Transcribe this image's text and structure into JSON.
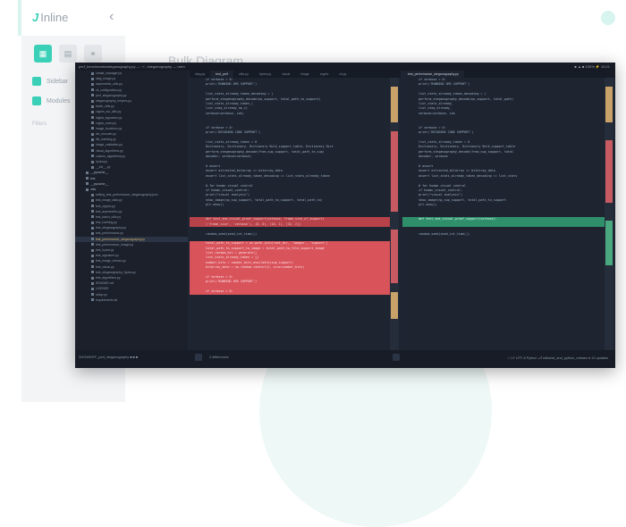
{
  "app": {
    "logo_mark": "J",
    "logo_text": "Inline",
    "collapse_glyph": "‹"
  },
  "sidebar": {
    "icons": [
      "grid-icon",
      "list-icon",
      "network-icon"
    ],
    "icon_glyphs": [
      "▦",
      "▤",
      "⚭"
    ],
    "items": [
      {
        "label": "Sidebar"
      },
      {
        "label": "Modules"
      }
    ],
    "filters_label": "Filters"
  },
  "page": {
    "title": "Bulk Diagram"
  },
  "editor": {
    "window_title": "perf_benchmarks/steganography.py — ~/.../steganography — nvim",
    "window_status": "■ ▲ ■ 100% ⚡ 10:21",
    "tree": [
      {
        "label": "create_manager.py",
        "type": "file"
      },
      {
        "label": "steg_image.py",
        "type": "file"
      },
      {
        "label": "asymmetric_utils.py",
        "type": "file"
      },
      {
        "label": "cli_configuration.py",
        "type": "file"
      },
      {
        "label": "perf_steganography.py",
        "type": "file"
      },
      {
        "label": "steganography_helpers.py",
        "type": "file"
      },
      {
        "label": "batch_utils.py",
        "type": "file"
      },
      {
        "label": "ctypes_ssl_utils.py",
        "type": "file"
      },
      {
        "label": "digital_signature.py",
        "type": "file"
      },
      {
        "label": "crypto_main.py",
        "type": "file"
      },
      {
        "label": "image_functions.py",
        "type": "file"
      },
      {
        "label": "lsb_encoder.py",
        "type": "file"
      },
      {
        "label": "file_hashing.py",
        "type": "file"
      },
      {
        "label": "image_validation.py",
        "type": "file"
      },
      {
        "label": "visual_algorithms.py",
        "type": "file"
      },
      {
        "label": "custom_algorithms.py",
        "type": "file"
      },
      {
        "label": "hydra.py",
        "type": "file"
      },
      {
        "label": "__init__.py",
        "type": "file"
      },
      {
        "label": "__pycache__",
        "type": "dir"
      },
      {
        "label": "test",
        "type": "dir"
      },
      {
        "label": "__pycache__",
        "type": "dir"
      },
      {
        "label": "utils",
        "type": "dir"
      },
      {
        "label": "setting_test_performance_steganography.json",
        "type": "file"
      },
      {
        "label": "test_image_data.py",
        "type": "file"
      },
      {
        "label": "test_ctypes.py",
        "type": "file"
      },
      {
        "label": "test_asymmetric.py",
        "type": "file"
      },
      {
        "label": "test_batch_utils.py",
        "type": "file"
      },
      {
        "label": "test_hashing.py",
        "type": "file"
      },
      {
        "label": "test_steganography.py",
        "type": "file"
      },
      {
        "label": "test_performance.py",
        "type": "file"
      },
      {
        "label": "test_performance_steganography.py",
        "type": "file",
        "selected": true
      },
      {
        "label": "test_performance_image.py",
        "type": "file"
      },
      {
        "label": "test_hydra.py",
        "type": "file"
      },
      {
        "label": "test_signature.py",
        "type": "file"
      },
      {
        "label": "test_image_checks.py",
        "type": "file"
      },
      {
        "label": "test_visual.py",
        "type": "file"
      },
      {
        "label": "test_steganography_hydra.py",
        "type": "file"
      },
      {
        "label": "test_algorithms.py",
        "type": "file"
      },
      {
        "label": "README.md",
        "type": "file"
      },
      {
        "label": "LICENSE",
        "type": "file"
      },
      {
        "label": "setup.py",
        "type": "file"
      },
      {
        "label": "requirements.txt",
        "type": "file"
      }
    ],
    "left_tabs": [
      "steg.py",
      "test_perf",
      "utils.py",
      "hydra.py",
      "visual",
      "image",
      "crypto",
      "cli.py"
    ],
    "right_tabs": [
      "test_performance_steganography.py"
    ],
    "left_code": [
      {
        "text": "if verbose > 0:",
        "kind": "normal"
      },
      {
        "text": "    print('RUNNING SMS SUPPORT')",
        "kind": "normal"
      },
      {
        "text": "",
        "kind": "normal"
      },
      {
        "text": "list_stats_already_taken_decoding = (",
        "kind": "normal"
      },
      {
        "text": "    perform_steganography_decode(np_support, total_path_to_support)",
        "kind": "normal"
      },
      {
        "text": "                                list_stats_already_taken_(",
        "kind": "normal"
      },
      {
        "text": "                                list_steg_already_sm_c)",
        "kind": "normal"
      },
      {
        "text": "                                verbose=verbose, ids)",
        "kind": "normal"
      },
      {
        "text": "",
        "kind": "normal"
      },
      {
        "text": "",
        "kind": "normal"
      },
      {
        "text": "if verbose > 0:",
        "kind": "normal"
      },
      {
        "text": "    print('DECODING CODE SUPPORT')",
        "kind": "normal"
      },
      {
        "text": "",
        "kind": "normal"
      },
      {
        "text": "list_stats_already_taken = 0",
        "kind": "normal"
      },
      {
        "text": "Dictionary, Dictionary, Dictionary Bulk_support_table, Dictionary Dict",
        "kind": "normal"
      },
      {
        "text": "    perform_steganography_decode(from_sup_support, total_path_to_sup)",
        "kind": "normal"
      },
      {
        "text": "                                decoder, verbose=verbose)",
        "kind": "normal"
      },
      {
        "text": "",
        "kind": "normal"
      },
      {
        "text": "# assert",
        "kind": "normal"
      },
      {
        "text": "assert extracted_bitarray == bitarray_data",
        "kind": "normal"
      },
      {
        "text": "assert list_stats_already_taken_decoding == list_stats_already_taken",
        "kind": "normal"
      },
      {
        "text": "",
        "kind": "normal"
      },
      {
        "text": "# for human visual control",
        "kind": "normal"
      },
      {
        "text": "if human_visual_control:",
        "kind": "normal"
      },
      {
        "text": "    print(\"visual analysis\")",
        "kind": "normal"
      },
      {
        "text": "    show_image(np_sup_support, total_path_to_support, total_path_to)",
        "kind": "normal"
      },
      {
        "text": "    plt.show()",
        "kind": "normal"
      },
      {
        "text": "",
        "kind": "normal"
      },
      {
        "text": "",
        "kind": "normal"
      },
      {
        "text": "def test_sms_visual_proof_support(verbose, frame_size_of_support)",
        "kind": "del"
      },
      {
        "text": "    ('frame_size', 'verbose'), (8, 0), (16, 1), [32, 2]]",
        "kind": "del"
      },
      {
        "text": "",
        "kind": "normal"
      },
      {
        "text": "random_seed(seed_int_time())",
        "kind": "normal"
      },
      {
        "text": "",
        "kind": "normal"
      },
      {
        "text": "total_path_to_support = os.path.join(root_dir, 'images', 'support')",
        "kind": "del2"
      },
      {
        "text": "total_path_to_support_to_image = total_path_to_file_support_image",
        "kind": "del2"
      },
      {
        "text": "list_random_bit = generate()",
        "kind": "del2"
      },
      {
        "text": "list_stats_already_taken = []",
        "kind": "del2"
      },
      {
        "text": "number_bits = number_bits_available(sup_support)",
        "kind": "del2"
      },
      {
        "text": "bitarray_data = np.random.randint(2, size=number_bits)",
        "kind": "del2"
      },
      {
        "text": "",
        "kind": "del2"
      },
      {
        "text": "    if verbose > 0:",
        "kind": "del2"
      },
      {
        "text": "        print('RUNNING SMS SUPPORT')",
        "kind": "del2"
      },
      {
        "text": "",
        "kind": "del2"
      },
      {
        "text": "    if verbose > 0:",
        "kind": "del2"
      }
    ],
    "right_code": [
      {
        "text": "if verbose > 0:",
        "kind": "normal"
      },
      {
        "text": "    print('RUNNING SMS SUPPORT')",
        "kind": "normal"
      },
      {
        "text": "",
        "kind": "normal"
      },
      {
        "text": "list_stats_already_taken_decoding = (",
        "kind": "normal"
      },
      {
        "text": "    perform_steganography_decode(np_support, total_path)",
        "kind": "normal"
      },
      {
        "text": "                                list_stats_already_",
        "kind": "normal"
      },
      {
        "text": "                                list_steg_already_",
        "kind": "normal"
      },
      {
        "text": "                                verbose=verbose, ids",
        "kind": "normal"
      },
      {
        "text": "",
        "kind": "normal"
      },
      {
        "text": "",
        "kind": "normal"
      },
      {
        "text": "if verbose > 0:",
        "kind": "normal"
      },
      {
        "text": "    print('DECODING CODE SUPPORT')",
        "kind": "normal"
      },
      {
        "text": "",
        "kind": "normal"
      },
      {
        "text": "list_stats_already_taken = 0",
        "kind": "normal"
      },
      {
        "text": "Dictionary, Dictionary, Dictionary Bulk_support_table",
        "kind": "normal"
      },
      {
        "text": "    perform_steganography_decode(from_sup_support, total",
        "kind": "normal"
      },
      {
        "text": "                                decoder, verbose",
        "kind": "normal"
      },
      {
        "text": "",
        "kind": "normal"
      },
      {
        "text": "# assert",
        "kind": "normal"
      },
      {
        "text": "assert extracted_bitarray == bitarray_data",
        "kind": "normal"
      },
      {
        "text": "assert list_stats_already_taken_decoding == list_stats",
        "kind": "normal"
      },
      {
        "text": "",
        "kind": "normal"
      },
      {
        "text": "# for human visual control",
        "kind": "normal"
      },
      {
        "text": "if human_visual_control:",
        "kind": "normal"
      },
      {
        "text": "    print(\"visual analysis\")",
        "kind": "normal"
      },
      {
        "text": "    show_image(np_sup_support, total_path_to_support",
        "kind": "normal"
      },
      {
        "text": "    plt.show()",
        "kind": "normal"
      },
      {
        "text": "",
        "kind": "normal"
      },
      {
        "text": "",
        "kind": "normal"
      },
      {
        "text": "def test_sms_visual_proof_support(verbose):",
        "kind": "add"
      },
      {
        "text": "",
        "kind": "add"
      },
      {
        "text": "",
        "kind": "normal"
      },
      {
        "text": "random_seed(seed_int_time())",
        "kind": "normal"
      }
    ],
    "diff_summary": "2 differences",
    "status_left": "SHOWDIFF_perf_steganography ■ ■ ■",
    "status_right": "✓ LF  UTF-8  Python  ⎇ editorial_and_python_release  ● 12 updates"
  },
  "colors": {
    "accent": "#3ad0b7",
    "deleted": "#b8424a",
    "added": "#2e8f6a"
  }
}
